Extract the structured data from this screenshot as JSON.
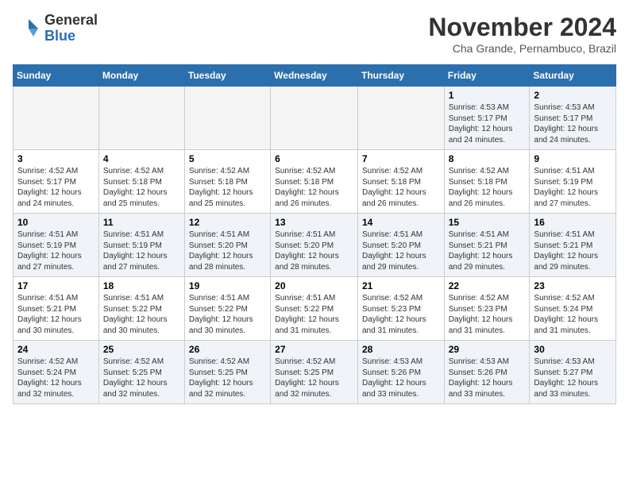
{
  "header": {
    "logo_line1": "General",
    "logo_line2": "Blue",
    "month": "November 2024",
    "location": "Cha Grande, Pernambuco, Brazil"
  },
  "days_of_week": [
    "Sunday",
    "Monday",
    "Tuesday",
    "Wednesday",
    "Thursday",
    "Friday",
    "Saturday"
  ],
  "weeks": [
    [
      {
        "day": "",
        "info": ""
      },
      {
        "day": "",
        "info": ""
      },
      {
        "day": "",
        "info": ""
      },
      {
        "day": "",
        "info": ""
      },
      {
        "day": "",
        "info": ""
      },
      {
        "day": "1",
        "info": "Sunrise: 4:53 AM\nSunset: 5:17 PM\nDaylight: 12 hours and 24 minutes."
      },
      {
        "day": "2",
        "info": "Sunrise: 4:53 AM\nSunset: 5:17 PM\nDaylight: 12 hours and 24 minutes."
      }
    ],
    [
      {
        "day": "3",
        "info": "Sunrise: 4:52 AM\nSunset: 5:17 PM\nDaylight: 12 hours and 24 minutes."
      },
      {
        "day": "4",
        "info": "Sunrise: 4:52 AM\nSunset: 5:18 PM\nDaylight: 12 hours and 25 minutes."
      },
      {
        "day": "5",
        "info": "Sunrise: 4:52 AM\nSunset: 5:18 PM\nDaylight: 12 hours and 25 minutes."
      },
      {
        "day": "6",
        "info": "Sunrise: 4:52 AM\nSunset: 5:18 PM\nDaylight: 12 hours and 26 minutes."
      },
      {
        "day": "7",
        "info": "Sunrise: 4:52 AM\nSunset: 5:18 PM\nDaylight: 12 hours and 26 minutes."
      },
      {
        "day": "8",
        "info": "Sunrise: 4:52 AM\nSunset: 5:18 PM\nDaylight: 12 hours and 26 minutes."
      },
      {
        "day": "9",
        "info": "Sunrise: 4:51 AM\nSunset: 5:19 PM\nDaylight: 12 hours and 27 minutes."
      }
    ],
    [
      {
        "day": "10",
        "info": "Sunrise: 4:51 AM\nSunset: 5:19 PM\nDaylight: 12 hours and 27 minutes."
      },
      {
        "day": "11",
        "info": "Sunrise: 4:51 AM\nSunset: 5:19 PM\nDaylight: 12 hours and 27 minutes."
      },
      {
        "day": "12",
        "info": "Sunrise: 4:51 AM\nSunset: 5:20 PM\nDaylight: 12 hours and 28 minutes."
      },
      {
        "day": "13",
        "info": "Sunrise: 4:51 AM\nSunset: 5:20 PM\nDaylight: 12 hours and 28 minutes."
      },
      {
        "day": "14",
        "info": "Sunrise: 4:51 AM\nSunset: 5:20 PM\nDaylight: 12 hours and 29 minutes."
      },
      {
        "day": "15",
        "info": "Sunrise: 4:51 AM\nSunset: 5:21 PM\nDaylight: 12 hours and 29 minutes."
      },
      {
        "day": "16",
        "info": "Sunrise: 4:51 AM\nSunset: 5:21 PM\nDaylight: 12 hours and 29 minutes."
      }
    ],
    [
      {
        "day": "17",
        "info": "Sunrise: 4:51 AM\nSunset: 5:21 PM\nDaylight: 12 hours and 30 minutes."
      },
      {
        "day": "18",
        "info": "Sunrise: 4:51 AM\nSunset: 5:22 PM\nDaylight: 12 hours and 30 minutes."
      },
      {
        "day": "19",
        "info": "Sunrise: 4:51 AM\nSunset: 5:22 PM\nDaylight: 12 hours and 30 minutes."
      },
      {
        "day": "20",
        "info": "Sunrise: 4:51 AM\nSunset: 5:22 PM\nDaylight: 12 hours and 31 minutes."
      },
      {
        "day": "21",
        "info": "Sunrise: 4:52 AM\nSunset: 5:23 PM\nDaylight: 12 hours and 31 minutes."
      },
      {
        "day": "22",
        "info": "Sunrise: 4:52 AM\nSunset: 5:23 PM\nDaylight: 12 hours and 31 minutes."
      },
      {
        "day": "23",
        "info": "Sunrise: 4:52 AM\nSunset: 5:24 PM\nDaylight: 12 hours and 31 minutes."
      }
    ],
    [
      {
        "day": "24",
        "info": "Sunrise: 4:52 AM\nSunset: 5:24 PM\nDaylight: 12 hours and 32 minutes."
      },
      {
        "day": "25",
        "info": "Sunrise: 4:52 AM\nSunset: 5:25 PM\nDaylight: 12 hours and 32 minutes."
      },
      {
        "day": "26",
        "info": "Sunrise: 4:52 AM\nSunset: 5:25 PM\nDaylight: 12 hours and 32 minutes."
      },
      {
        "day": "27",
        "info": "Sunrise: 4:52 AM\nSunset: 5:25 PM\nDaylight: 12 hours and 32 minutes."
      },
      {
        "day": "28",
        "info": "Sunrise: 4:53 AM\nSunset: 5:26 PM\nDaylight: 12 hours and 33 minutes."
      },
      {
        "day": "29",
        "info": "Sunrise: 4:53 AM\nSunset: 5:26 PM\nDaylight: 12 hours and 33 minutes."
      },
      {
        "day": "30",
        "info": "Sunrise: 4:53 AM\nSunset: 5:27 PM\nDaylight: 12 hours and 33 minutes."
      }
    ]
  ]
}
